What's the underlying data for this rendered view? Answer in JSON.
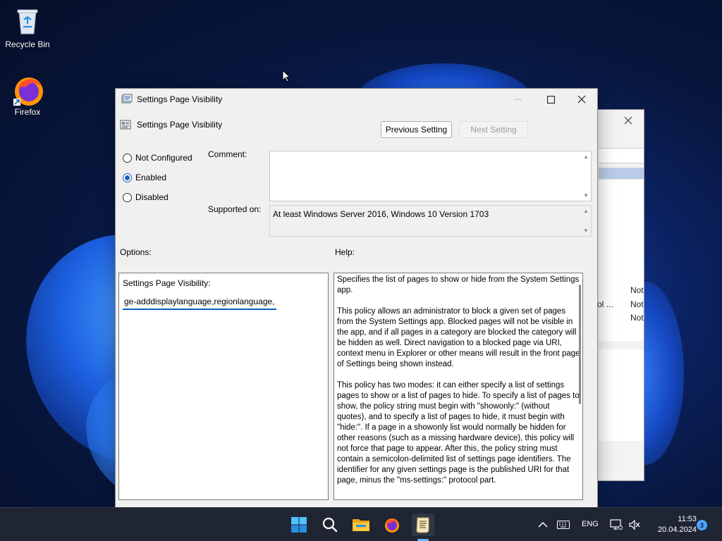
{
  "desktop": {
    "icons": [
      {
        "label": "Recycle Bin",
        "icon": "recycle-bin-icon"
      },
      {
        "label": "Firefox",
        "icon": "firefox-icon"
      }
    ]
  },
  "background_window": {
    "rows": [
      "Not",
      "ntrol ...",
      "Not",
      "Not"
    ]
  },
  "dialog": {
    "title": "Settings Page Visibility",
    "setting_name": "Settings Page Visibility",
    "previous_button": "Previous Setting",
    "next_button": "Next Setting",
    "radio": {
      "not_configured": "Not Configured",
      "enabled": "Enabled",
      "disabled": "Disabled",
      "selected": "enabled"
    },
    "comment_label": "Comment:",
    "comment_value": "",
    "supported_on_label": "Supported on:",
    "supported_on_value": "At least Windows Server 2016, Windows 10 Version 1703",
    "options_label": "Options:",
    "help_label": "Help:",
    "options": {
      "field_label": "Settings Page Visibility:",
      "field_value": "ge-adddisplaylanguage,regionlanguage,"
    },
    "help": {
      "p1": "Specifies the list of pages to show or hide from the System Settings app.",
      "p2": "This policy allows an administrator to block a given set of pages from the System Settings app. Blocked pages will not be visible in the app, and if all pages in a category are blocked the category will be hidden as well. Direct navigation to a blocked page via URI, context menu in Explorer or other means will result in the front page of Settings being shown instead.",
      "p3": "This policy has two modes: it can either specify a list of settings pages to show or a list of pages to hide. To specify a list of pages to show, the policy string must begin with \"showonly:\" (without quotes), and to specify a list of pages to hide, it must begin with \"hide:\". If a page in a showonly list would normally be hidden for other reasons (such as a missing hardware device), this policy will not force that page to appear. After this, the policy string must contain a semicolon-delimited list of settings page identifiers. The identifier for any given settings page is the published URI for that page, minus the \"ms-settings:\" protocol part."
    }
  },
  "taskbar": {
    "apps": [
      "start-icon",
      "search-icon",
      "file-explorer-icon",
      "firefox-icon",
      "policy-editor-icon"
    ],
    "language": "ENG",
    "time": "11:53",
    "date": "20.04.2024",
    "notification_count": "3"
  },
  "colors": {
    "accent": "#1a5fb4",
    "taskbar": "#1f2533"
  }
}
